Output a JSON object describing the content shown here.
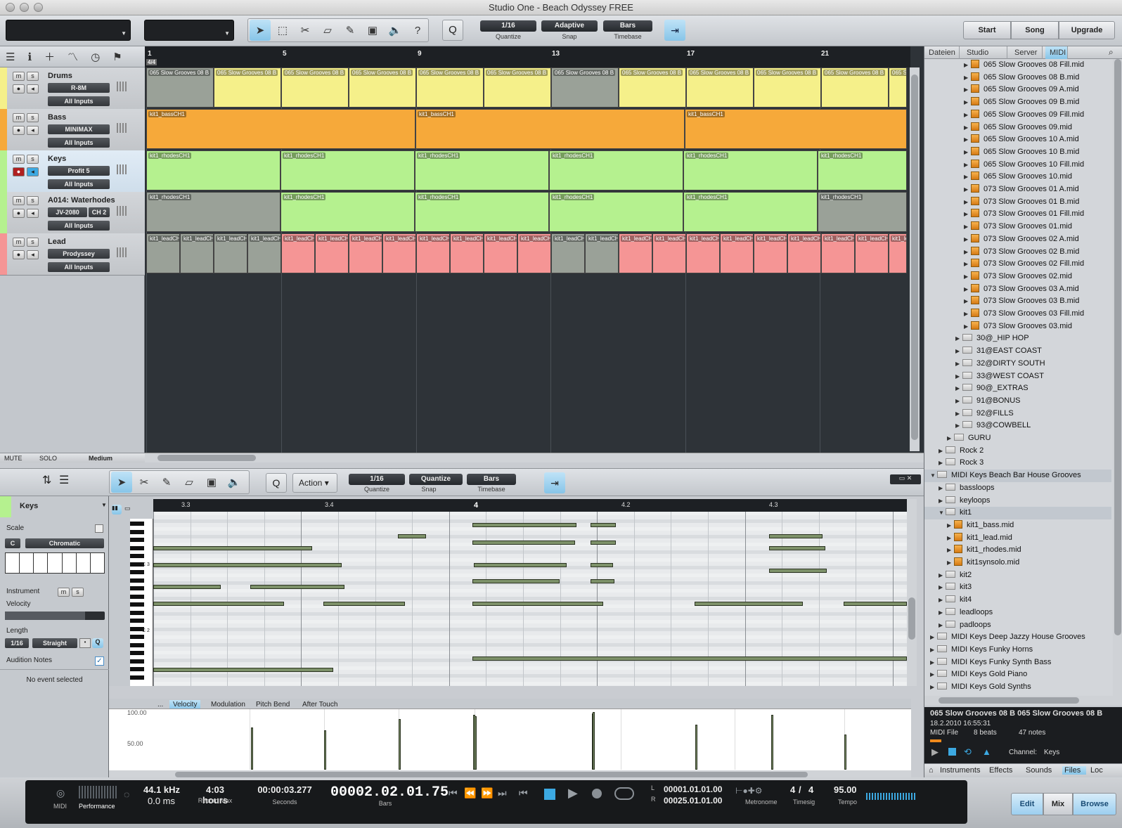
{
  "window": {
    "title": "Studio One - Beach Odyssey FREE"
  },
  "toolbar": {
    "quantize": {
      "value": "1/16",
      "label": "Quantize"
    },
    "snap": {
      "value": "Adaptive",
      "label": "Snap"
    },
    "timebase": {
      "value": "Bars",
      "label": "Timebase"
    },
    "q_label": "Q",
    "help_label": "?",
    "start": "Start",
    "song": "Song",
    "upgrade": "Upgrade"
  },
  "ruler": {
    "marks": [
      "1",
      "5",
      "9",
      "13",
      "17",
      "21"
    ],
    "timesig": "4/4"
  },
  "tracks": [
    {
      "name": "Drums",
      "instrument": "R-8M",
      "input": "All Inputs",
      "color": "#f5f08a"
    },
    {
      "name": "Bass",
      "instrument": "MINIMAX",
      "input": "All Inputs",
      "color": "#f6a93a"
    },
    {
      "name": "Keys",
      "instrument": "Profit 5",
      "input": "All Inputs",
      "color": "#b5f18f"
    },
    {
      "name": "A014: Waterhodes",
      "instrument": "JV-2080",
      "channel": "CH 2",
      "input": "All Inputs",
      "color": "#b5f18f"
    },
    {
      "name": "Lead",
      "instrument": "Prodyssey",
      "input": "All Inputs",
      "color": "#f59595"
    }
  ],
  "parts": {
    "drums": "065 Slow Grooves 08 B",
    "bass": "kit1_bassCH1",
    "keys": "kit1_rhodesCH1",
    "lead": "kit1_leadCH1"
  },
  "trackfooter": {
    "mute": "MUTE",
    "solo": "SOLO",
    "size": "Medium"
  },
  "browser": {
    "tabs": [
      "Dateien",
      "Studio One",
      "Server",
      "MIDI"
    ],
    "items": [
      {
        "label": "065 Slow Grooves 08 Fill.mid",
        "type": "file",
        "indent": 4
      },
      {
        "label": "065 Slow Grooves 08 B.mid",
        "type": "file",
        "indent": 4
      },
      {
        "label": "065 Slow Grooves 09 A.mid",
        "type": "file",
        "indent": 4
      },
      {
        "label": "065 Slow Grooves 09 B.mid",
        "type": "file",
        "indent": 4
      },
      {
        "label": "065 Slow Grooves 09 Fill.mid",
        "type": "file",
        "indent": 4
      },
      {
        "label": "065 Slow Grooves 09.mid",
        "type": "file",
        "indent": 4
      },
      {
        "label": "065 Slow Grooves 10 A.mid",
        "type": "file",
        "indent": 4
      },
      {
        "label": "065 Slow Grooves 10 B.mid",
        "type": "file",
        "indent": 4
      },
      {
        "label": "065 Slow Grooves 10 Fill.mid",
        "type": "file",
        "indent": 4
      },
      {
        "label": "065 Slow Grooves 10.mid",
        "type": "file",
        "indent": 4
      },
      {
        "label": "073 Slow Grooves 01 A.mid",
        "type": "file",
        "indent": 4
      },
      {
        "label": "073 Slow Grooves 01 B.mid",
        "type": "file",
        "indent": 4
      },
      {
        "label": "073 Slow Grooves 01 Fill.mid",
        "type": "file",
        "indent": 4
      },
      {
        "label": "073 Slow Grooves 01.mid",
        "type": "file",
        "indent": 4
      },
      {
        "label": "073 Slow Grooves 02 A.mid",
        "type": "file",
        "indent": 4
      },
      {
        "label": "073 Slow Grooves 02 B.mid",
        "type": "file",
        "indent": 4
      },
      {
        "label": "073 Slow Grooves 02 Fill.mid",
        "type": "file",
        "indent": 4
      },
      {
        "label": "073 Slow Grooves 02.mid",
        "type": "file",
        "indent": 4
      },
      {
        "label": "073 Slow Grooves 03 A.mid",
        "type": "file",
        "indent": 4
      },
      {
        "label": "073 Slow Grooves 03 B.mid",
        "type": "file",
        "indent": 4
      },
      {
        "label": "073 Slow Grooves 03 Fill.mid",
        "type": "file",
        "indent": 4
      },
      {
        "label": "073 Slow Grooves 03.mid",
        "type": "file",
        "indent": 4
      },
      {
        "label": "30@_HIP HOP",
        "type": "folder",
        "indent": 3
      },
      {
        "label": "31@EAST COAST",
        "type": "folder",
        "indent": 3
      },
      {
        "label": "32@DIRTY SOUTH",
        "type": "folder",
        "indent": 3
      },
      {
        "label": "33@WEST COAST",
        "type": "folder",
        "indent": 3
      },
      {
        "label": "90@_EXTRAS",
        "type": "folder",
        "indent": 3
      },
      {
        "label": "91@BONUS",
        "type": "folder",
        "indent": 3
      },
      {
        "label": "92@FILLS",
        "type": "folder",
        "indent": 3
      },
      {
        "label": "93@COWBELL",
        "type": "folder",
        "indent": 3
      },
      {
        "label": "GURU",
        "type": "folder",
        "indent": 2
      },
      {
        "label": "Rock 2",
        "type": "folder",
        "indent": 1
      },
      {
        "label": "Rock 3",
        "type": "folder",
        "indent": 1
      },
      {
        "label": "MIDI Keys Beach Bar House Grooves",
        "type": "folder",
        "indent": 0,
        "open": true
      },
      {
        "label": "bassloops",
        "type": "folder",
        "indent": 1
      },
      {
        "label": "keyloops",
        "type": "folder",
        "indent": 1
      },
      {
        "label": "kit1",
        "type": "folder",
        "indent": 1,
        "open": true
      },
      {
        "label": "kit1_bass.mid",
        "type": "file",
        "indent": 2
      },
      {
        "label": "kit1_lead.mid",
        "type": "file",
        "indent": 2
      },
      {
        "label": "kit1_rhodes.mid",
        "type": "file",
        "indent": 2
      },
      {
        "label": "kit1synsolo.mid",
        "type": "file",
        "indent": 2
      },
      {
        "label": "kit2",
        "type": "folder",
        "indent": 1
      },
      {
        "label": "kit3",
        "type": "folder",
        "indent": 1
      },
      {
        "label": "kit4",
        "type": "folder",
        "indent": 1
      },
      {
        "label": "leadloops",
        "type": "folder",
        "indent": 1
      },
      {
        "label": "padloops",
        "type": "folder",
        "indent": 1
      },
      {
        "label": "MIDI Keys Deep Jazzy House Grooves",
        "type": "folder",
        "indent": 0
      },
      {
        "label": "MIDI Keys Funky Horns",
        "type": "folder",
        "indent": 0
      },
      {
        "label": "MIDI Keys Funky Synth Bass",
        "type": "folder",
        "indent": 0
      },
      {
        "label": "MIDI Keys Gold Piano",
        "type": "folder",
        "indent": 0
      },
      {
        "label": "MIDI Keys Gold Synths",
        "type": "folder",
        "indent": 0
      }
    ],
    "info": {
      "name": "065 Slow Grooves 08 B 065 Slow Grooves 08 B",
      "date": "18.2.2010 16:55:31",
      "type": "MIDI File",
      "beats": "8 beats",
      "notes": "47 notes",
      "channel_label": "Channel:",
      "channel": "Keys"
    },
    "bottomtabs": [
      "Instruments",
      "Effects",
      "Sounds",
      "Files",
      "Loc"
    ]
  },
  "editor": {
    "action": "Action",
    "quantize": {
      "value": "1/16",
      "label": "Quantize"
    },
    "snap": {
      "value": "Quantize",
      "label": "Snap"
    },
    "timebase": {
      "value": "Bars",
      "label": "Timebase"
    },
    "q_label": "Q",
    "ruler": [
      "3.3",
      "3.4",
      "4",
      "4.2",
      "4.3"
    ],
    "keylabels": [
      "C 3",
      "C 2"
    ]
  },
  "inspector": {
    "track": "Keys",
    "scale_label": "Scale",
    "scale_root": "C",
    "scale_type": "Chromatic",
    "instrument_label": "Instrument",
    "velocity_label": "Velocity",
    "length_label": "Length",
    "length_value": "1/16",
    "length_mode": "Straight",
    "audition": "Audition Notes",
    "status": "No event selected"
  },
  "velocity": {
    "tabs": [
      "...",
      "Velocity",
      "Modulation",
      "Pitch Bend",
      "After Touch"
    ],
    "scale": [
      "100.00",
      "50.00",
      "0.00"
    ]
  },
  "transport": {
    "midi": "MIDI",
    "performance": "Performance",
    "samplerate": "44.1 kHz",
    "latency": "0.0 ms",
    "recordmax": "4:03 hours",
    "recordmax_label": "Record Max",
    "seconds": "00:00:03.277",
    "seconds_label": "Seconds",
    "bars": "00002.02.01.75",
    "bars_label": "Bars",
    "loop_l": "00001.01.01.00",
    "loop_r": "00025.01.01.00",
    "metronome_label": "Metronome",
    "timesig_num": "4",
    "timesig_den": "4",
    "timesig_label": "Timesig",
    "tempo": "95.00",
    "tempo_label": "Tempo",
    "l": "L",
    "r": "R",
    "edit": "Edit",
    "mix": "Mix",
    "browse": "Browse"
  }
}
